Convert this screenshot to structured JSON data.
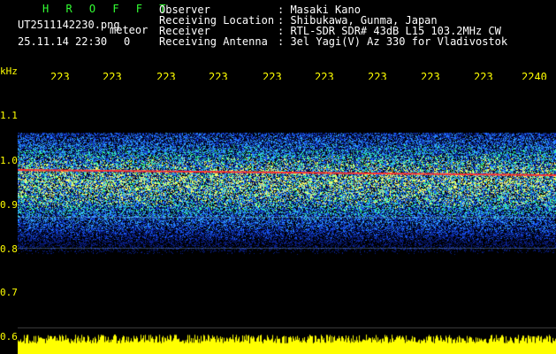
{
  "app": {
    "title": "H R O F F T",
    "filename": "UT2511142230.png",
    "meteor_label": "meteor",
    "timestamp": "25.11.14 22:30",
    "count": "0"
  },
  "info": {
    "labels": [
      "Observer",
      "Receiving Location",
      "Receiver",
      "Receiving Antenna"
    ],
    "values": [
      ": Masaki Kano",
      ": Shibukawa, Gunma, Japan",
      ": RTL-SDR SDR# 43dB L15 103.2MHz CW",
      ": 3el Yagi(V) Az 330 for Vladivostok"
    ]
  },
  "axis": {
    "unit": "kHz",
    "y_ticks": [
      "1.1",
      "1.0",
      "0.9",
      "0.8",
      "0.7",
      "0.6"
    ],
    "x_ticks": [
      "223",
      "223",
      "223",
      "223",
      "223",
      "223",
      "223",
      "223",
      "223",
      "2240"
    ]
  },
  "colors": {
    "background": "#000000",
    "signal_line": "#ff3333",
    "tick_text": "#ffff00",
    "header_title": "#33ff33"
  }
}
